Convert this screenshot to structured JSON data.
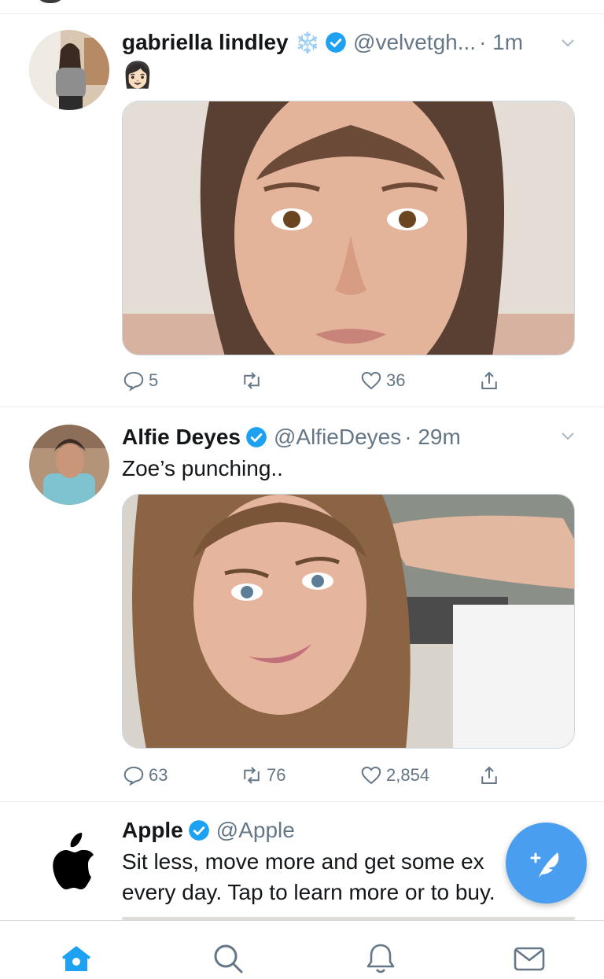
{
  "colors": {
    "accent": "#1da1f2",
    "muted": "#657786",
    "text": "#14171a",
    "compose": "#4a9ef0"
  },
  "tweets": [
    {
      "name": "gabriella lindley",
      "name_emoji": "❄️",
      "handle": "@velvetgh...",
      "time": "· 1m",
      "text": "👩🏻",
      "media": "selfie-photo",
      "replies": "5",
      "retweets": "",
      "likes": "36"
    },
    {
      "name": "Alfie Deyes",
      "handle": "@AlfieDeyes",
      "time": "· 29m",
      "text": "Zoe’s punching..",
      "media": "selfie-photo",
      "replies": "63",
      "retweets": "76",
      "likes": "2,854"
    },
    {
      "name": "Apple",
      "handle": "@Apple",
      "time": "",
      "text_line1": "Sit less, move more and get some ex",
      "text_line2": "every day. Tap to learn more or to buy."
    }
  ],
  "icons": {
    "reply": "reply-icon",
    "retweet": "retweet-icon",
    "like": "heart-icon",
    "share": "share-icon",
    "verified": "verified-badge-icon",
    "chevron": "chevron-down-icon",
    "compose": "compose-tweet-icon",
    "home": "home-icon",
    "search": "search-icon",
    "notifications": "bell-icon",
    "messages": "mail-icon"
  }
}
